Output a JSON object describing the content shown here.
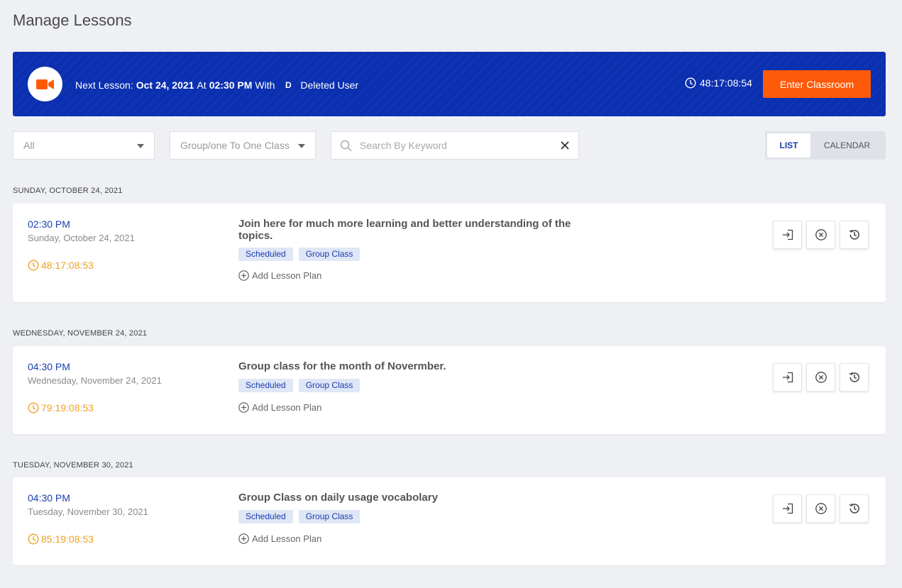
{
  "page": {
    "title": "Manage Lessons"
  },
  "banner": {
    "prefix": "Next Lesson:",
    "date": "Oct 24, 2021",
    "at": "At",
    "time": "02:30 PM",
    "with": "With",
    "avatar_initial": "D",
    "user": "Deleted User",
    "countdown": "48:17:08:54",
    "enter_label": "Enter Classroom",
    "bg_color": "#0a2fb0",
    "button_color": "#ff5a0a"
  },
  "filters": {
    "status_value": "All",
    "type_value": "Group/one To One Class",
    "search_placeholder": "Search By Keyword",
    "view_list": "LIST",
    "view_calendar": "CALENDAR"
  },
  "lessons": [
    {
      "heading": "SUNDAY, OCTOBER 24, 2021",
      "time": "02:30 PM",
      "date": "Sunday, October 24, 2021",
      "countdown": "48:17:08:53",
      "title": "Join here for much more learning and better understanding of the topics.",
      "tags": [
        "Scheduled",
        "Group Class"
      ],
      "add_plan": "Add Lesson Plan"
    },
    {
      "heading": "WEDNESDAY, NOVEMBER 24, 2021",
      "time": "04:30 PM",
      "date": "Wednesday, November 24, 2021",
      "countdown": "79:19:08:53",
      "title": "Group class for the month of Novermber.",
      "tags": [
        "Scheduled",
        "Group Class"
      ],
      "add_plan": "Add Lesson Plan"
    },
    {
      "heading": "TUESDAY, NOVEMBER 30, 2021",
      "time": "04:30 PM",
      "date": "Tuesday, November 30, 2021",
      "countdown": "85:19:08:53",
      "title": "Group Class on daily usage vocabolary",
      "tags": [
        "Scheduled",
        "Group Class"
      ],
      "add_plan": "Add Lesson Plan"
    }
  ],
  "icons": {
    "camera": "video-camera-icon",
    "clock": "clock-icon",
    "search": "search-icon",
    "clear": "close-icon",
    "add": "plus-circle-icon",
    "enter": "enter-icon",
    "cancel": "cancel-circle-icon",
    "history": "history-icon"
  }
}
